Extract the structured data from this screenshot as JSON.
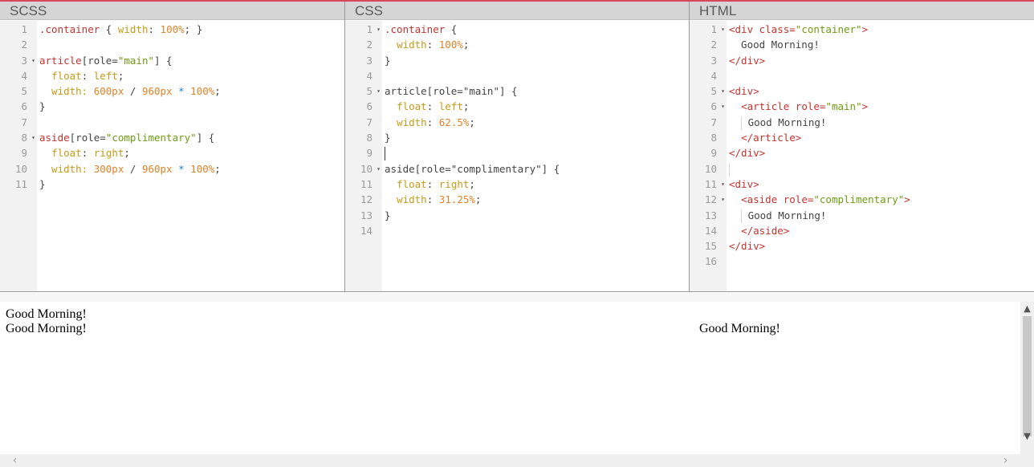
{
  "accent_color": "#d9475c",
  "panes": [
    {
      "title": "SCSS",
      "line_numbers": [
        "1",
        "2",
        "3",
        "4",
        "5",
        "6",
        "7",
        "8",
        "9",
        "10",
        "11"
      ],
      "folds": [
        3,
        8
      ]
    },
    {
      "title": "CSS",
      "line_numbers": [
        "1",
        "2",
        "3",
        "4",
        "5",
        "6",
        "7",
        "8",
        "9",
        "10",
        "11",
        "12",
        "13",
        "14"
      ],
      "folds": [
        1,
        5,
        10
      ]
    },
    {
      "title": "HTML",
      "line_numbers": [
        "1",
        "2",
        "3",
        "4",
        "5",
        "6",
        "7",
        "8",
        "9",
        "10",
        "11",
        "12",
        "13",
        "14",
        "15",
        "16"
      ],
      "folds": [
        1,
        5,
        6,
        11,
        12
      ]
    }
  ],
  "scss": {
    "l1": [
      ".container",
      " { ",
      "width",
      ": ",
      "100%",
      "; }"
    ],
    "l3": [
      "article",
      "[role=",
      "\"main\"",
      "] {"
    ],
    "l4": [
      "  ",
      "float",
      ": ",
      "left",
      ";"
    ],
    "l5": [
      "  width: ",
      "600px",
      " / ",
      "960px",
      " * ",
      "100%",
      ";"
    ],
    "l6": "}",
    "l8": [
      "aside",
      "[role=",
      "\"complimentary\"",
      "] {"
    ],
    "l9": [
      "  ",
      "float",
      ": ",
      "right",
      ";"
    ],
    "l10": [
      "  width: ",
      "300px",
      " / ",
      "960px",
      " * ",
      "100%",
      ";"
    ],
    "l11": "}"
  },
  "css": {
    "l1": [
      ".container",
      " {"
    ],
    "l2": [
      "  ",
      "width",
      ": ",
      "100%",
      ";"
    ],
    "l3": "}",
    "l5": [
      "article[role=\"main\"] {"
    ],
    "l6": [
      "  ",
      "float",
      ": ",
      "left",
      ";"
    ],
    "l7": [
      "  ",
      "width",
      ": ",
      "62.5%",
      ";"
    ],
    "l8": "}",
    "l10": [
      "aside[role=\"complimentary\"] {"
    ],
    "l11": [
      "  ",
      "float",
      ": ",
      "right",
      ";"
    ],
    "l12": [
      "  ",
      "width",
      ": ",
      "31.25%",
      ";"
    ],
    "l13": "}"
  },
  "html": {
    "l1": [
      "<div",
      " class=",
      "\"container\"",
      ">"
    ],
    "l2": "  Good Morning!",
    "l3": "</div>",
    "l5": "<div>",
    "l6": [
      "  ",
      "<article",
      " role=",
      "\"main\"",
      ">"
    ],
    "l7": "Good Morning!",
    "l8": [
      "  ",
      "</article>"
    ],
    "l9": "</div>",
    "l11": "<div>",
    "l12": [
      "  ",
      "<aside",
      " role=",
      "\"complimentary\"",
      ">"
    ],
    "l13": "Good Morning!",
    "l14": [
      "  ",
      "</aside>"
    ],
    "l15": "</div>"
  },
  "preview": {
    "line1": "Good Morning!",
    "line2": "Good Morning!",
    "line3": "Good Morning!"
  },
  "scroll_icons": {
    "up": "▲",
    "down": "▼",
    "left": "‹",
    "right": "›"
  }
}
